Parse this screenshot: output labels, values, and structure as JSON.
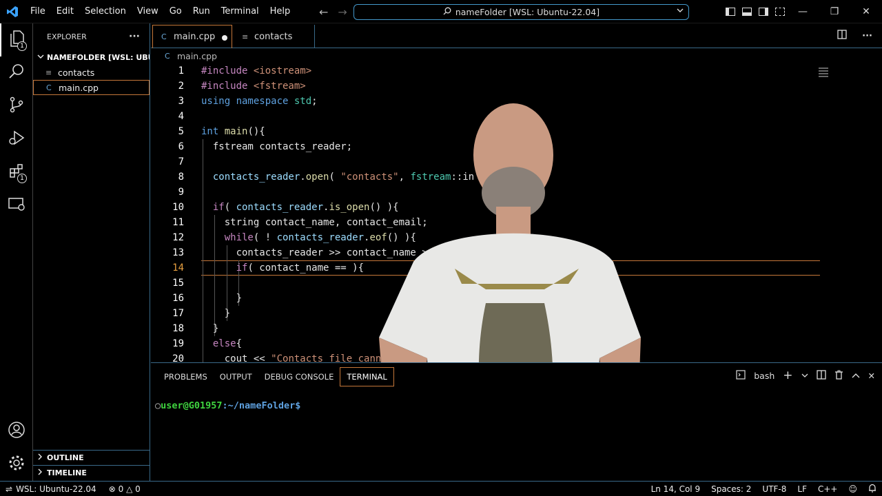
{
  "titlebar": {
    "menu": [
      "File",
      "Edit",
      "Selection",
      "View",
      "Go",
      "Run",
      "Terminal",
      "Help"
    ],
    "command_center": "nameFolder [WSL: Ubuntu-22.04]"
  },
  "activity": {
    "explorer_badge": "1",
    "extensions_badge": "1"
  },
  "sidebar": {
    "title": "EXPLORER",
    "more": "···",
    "folder": "NAMEFOLDER [WSL: UBU...",
    "files": [
      "contacts",
      "main.cpp"
    ],
    "outline": "OUTLINE",
    "timeline": "TIMELINE"
  },
  "tabs": {
    "main": "main.cpp",
    "contacts": "contacts"
  },
  "breadcrumb": "main.cpp",
  "code": [
    {
      "n": "1",
      "parts": [
        [
          "pp",
          "#include "
        ],
        [
          "str",
          "<iostream>"
        ]
      ]
    },
    {
      "n": "2",
      "parts": [
        [
          "pp",
          "#include "
        ],
        [
          "str",
          "<fstream>"
        ]
      ]
    },
    {
      "n": "3",
      "parts": [
        [
          "kw",
          "using "
        ],
        [
          "kw",
          "namespace "
        ],
        [
          "ns",
          "std"
        ],
        [
          "plain",
          ";"
        ]
      ]
    },
    {
      "n": "4",
      "parts": []
    },
    {
      "n": "5",
      "parts": [
        [
          "ty",
          "int "
        ],
        [
          "fn",
          "main"
        ],
        [
          "plain",
          "(){"
        ]
      ]
    },
    {
      "n": "6",
      "parts": [
        [
          "plain",
          "  fstream contacts_reader;"
        ]
      ]
    },
    {
      "n": "7",
      "parts": []
    },
    {
      "n": "8",
      "parts": [
        [
          "var",
          "  contacts_reader"
        ],
        [
          "plain",
          "."
        ],
        [
          "fn",
          "open"
        ],
        [
          "plain",
          "( "
        ],
        [
          "str",
          "\"contacts\""
        ],
        [
          "plain",
          ", "
        ],
        [
          "ns",
          "fstream"
        ],
        [
          "plain",
          "::in );"
        ]
      ]
    },
    {
      "n": "9",
      "parts": []
    },
    {
      "n": "10",
      "parts": [
        [
          "pp",
          "  if"
        ],
        [
          "plain",
          "( "
        ],
        [
          "var",
          "contacts_reader"
        ],
        [
          "plain",
          "."
        ],
        [
          "fn",
          "is_open"
        ],
        [
          "plain",
          "() ){"
        ]
      ]
    },
    {
      "n": "11",
      "parts": [
        [
          "plain",
          "    string contact_name, contact_email;"
        ]
      ]
    },
    {
      "n": "12",
      "parts": [
        [
          "pp",
          "    while"
        ],
        [
          "plain",
          "( ! "
        ],
        [
          "var",
          "contacts_reader"
        ],
        [
          "plain",
          "."
        ],
        [
          "fn",
          "eof"
        ],
        [
          "plain",
          "() ){"
        ]
      ]
    },
    {
      "n": "13",
      "parts": [
        [
          "plain",
          "      contacts_reader >> contact_name >> contact_email;"
        ]
      ]
    },
    {
      "n": "14",
      "parts": [
        [
          "pp",
          "      if"
        ],
        [
          "plain",
          "( contact_name == ){"
        ]
      ]
    },
    {
      "n": "15",
      "parts": []
    },
    {
      "n": "16",
      "parts": [
        [
          "plain",
          "      }"
        ]
      ]
    },
    {
      "n": "17",
      "parts": [
        [
          "plain",
          "    }"
        ]
      ]
    },
    {
      "n": "18",
      "parts": [
        [
          "plain",
          "  }"
        ]
      ]
    },
    {
      "n": "19",
      "parts": [
        [
          "pp",
          "  else"
        ],
        [
          "plain",
          "{"
        ]
      ]
    },
    {
      "n": "20",
      "parts": [
        [
          "plain",
          "    cout << "
        ],
        [
          "str",
          "\"Contacts file cannot be opened.\\n\""
        ],
        [
          "plain",
          ";"
        ]
      ]
    }
  ],
  "current_line": "14",
  "panel": {
    "tabs": [
      "PROBLEMS",
      "OUTPUT",
      "DEBUG CONSOLE",
      "TERMINAL"
    ],
    "active_tab": "TERMINAL",
    "shell": "bash",
    "prompt_user": "user@G01957",
    "prompt_path": ":~/nameFolder$"
  },
  "status": {
    "remote": "WSL: Ubuntu-22.04",
    "errors": "0",
    "warnings": "0",
    "position": "Ln 14, Col 9",
    "spaces": "Spaces: 2",
    "encoding": "UTF-8",
    "eol": "LF",
    "language": "C++"
  }
}
